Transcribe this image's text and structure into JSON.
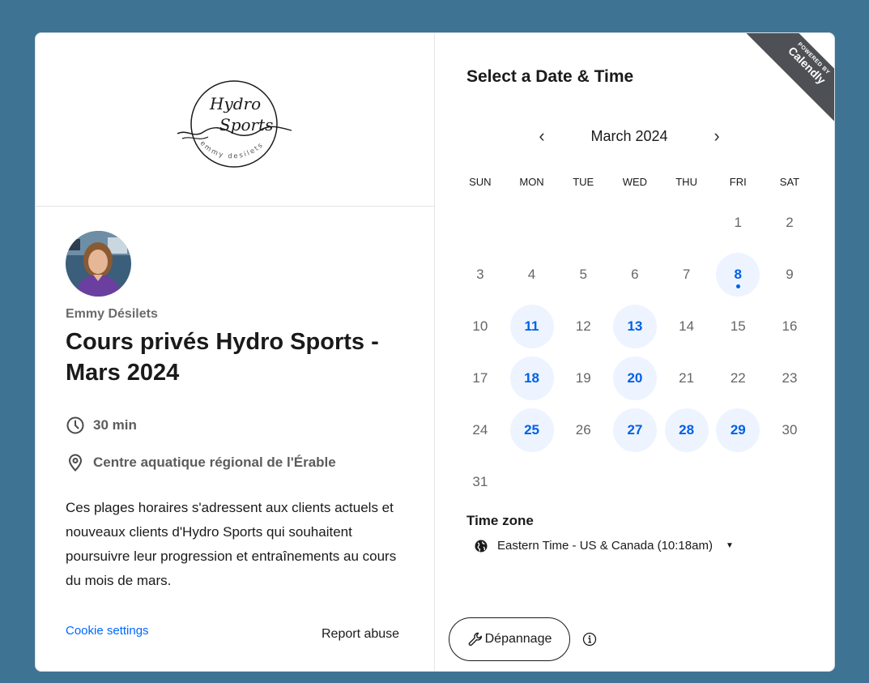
{
  "host": {
    "name": "Emmy Désilets"
  },
  "logo": {
    "line1": "Hydro",
    "line2": "Sports",
    "arc_text": "emmy desilets"
  },
  "event": {
    "title": "Cours privés Hydro Sports - Mars 2024",
    "duration": "30 min",
    "location": "Centre aquatique régional de l'Érable",
    "description": "Ces plages horaires s'adressent aux clients actuels et nouveaux clients d'Hydro Sports qui souhaitent poursuivre leur progression et entraînements au cours du mois de mars."
  },
  "footer": {
    "cookie_settings": "Cookie settings",
    "report_abuse": "Report abuse"
  },
  "badge": {
    "powered_by": "POWERED BY",
    "brand": "Calendly"
  },
  "calendar": {
    "heading": "Select a Date & Time",
    "month_label": "March 2024",
    "prev_icon": "chevron-left-icon",
    "next_icon": "chevron-right-icon",
    "weekdays": [
      "SUN",
      "MON",
      "TUE",
      "WED",
      "THU",
      "FRI",
      "SAT"
    ],
    "leading_blanks": 5,
    "days_in_month": 31,
    "available_days": [
      8,
      11,
      13,
      18,
      20,
      25,
      27,
      28,
      29
    ],
    "today": 8
  },
  "timezone": {
    "label": "Time zone",
    "value": "Eastern Time - US & Canada (10:18am)",
    "icon": "globe-icon"
  },
  "troubleshoot": {
    "label": "Dépannage",
    "icon": "wrench-icon"
  },
  "colors": {
    "background": "#3f7393",
    "accent": "#0060e6",
    "available_bg": "#edf4ff",
    "link": "#0069ff",
    "ribbon": "#4d5055"
  }
}
